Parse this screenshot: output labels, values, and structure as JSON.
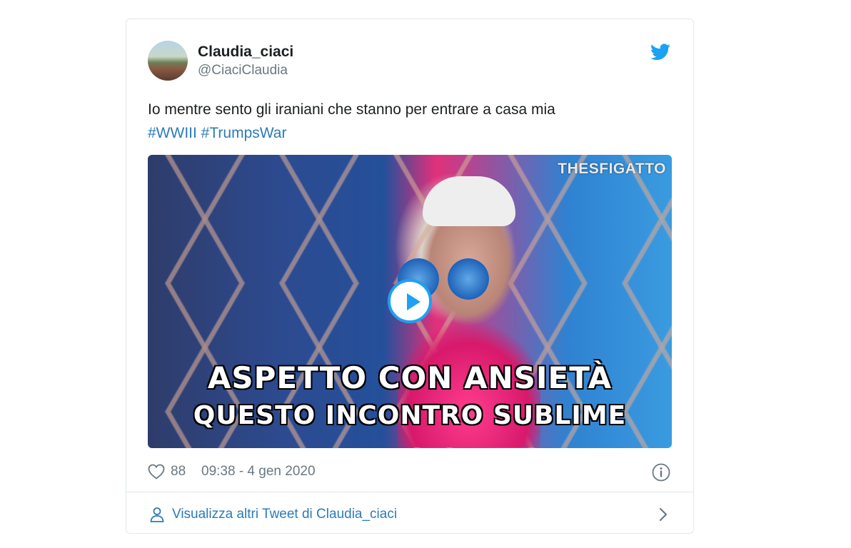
{
  "author": {
    "display_name": "Claudia_ciaci",
    "handle": "@CiaciClaudia"
  },
  "icons": {
    "brand": "twitter-bird-icon",
    "like": "heart-icon",
    "info": "info-icon",
    "profile": "person-icon",
    "navigate": "chevron-right-icon",
    "play": "play-icon"
  },
  "tweet": {
    "text": "Io mentre sento gli iraniani che stanno per entrare a casa mia",
    "hashtags": [
      "#WWIII",
      "#TrumpsWar"
    ]
  },
  "media": {
    "watermark": "THESFIGATTO",
    "caption_line1": "ASPETTO CON ANSIETÀ",
    "caption_line2": "QUESTO INCONTRO SUBLIME"
  },
  "footer": {
    "like_count": "88",
    "timestamp": "09:38 - 4 gen 2020"
  },
  "more": {
    "label": "Visualizza altri Tweet di Claudia_ciaci"
  },
  "colors": {
    "brand_blue": "#1da1f2",
    "link_blue": "#2b7bb9",
    "secondary_text": "#697882",
    "border": "#e1e8ed"
  }
}
